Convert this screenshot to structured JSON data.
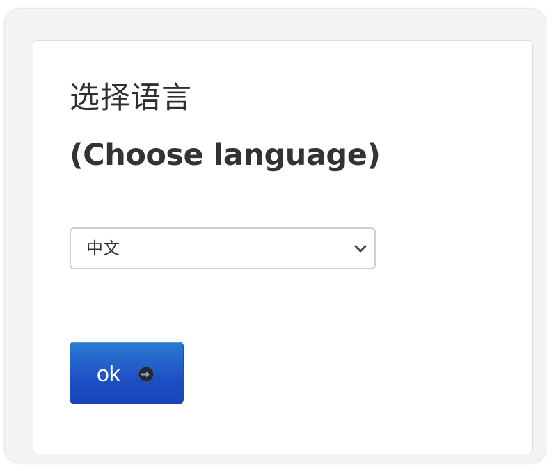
{
  "dialog": {
    "title_zh": "选择语言",
    "title_en": "(Choose language)"
  },
  "language_select": {
    "selected": "中文",
    "icon": "chevron-down-icon"
  },
  "ok_button": {
    "label": "ok",
    "icon": "arrow-right-circle-icon",
    "color": "#1d50c4"
  }
}
